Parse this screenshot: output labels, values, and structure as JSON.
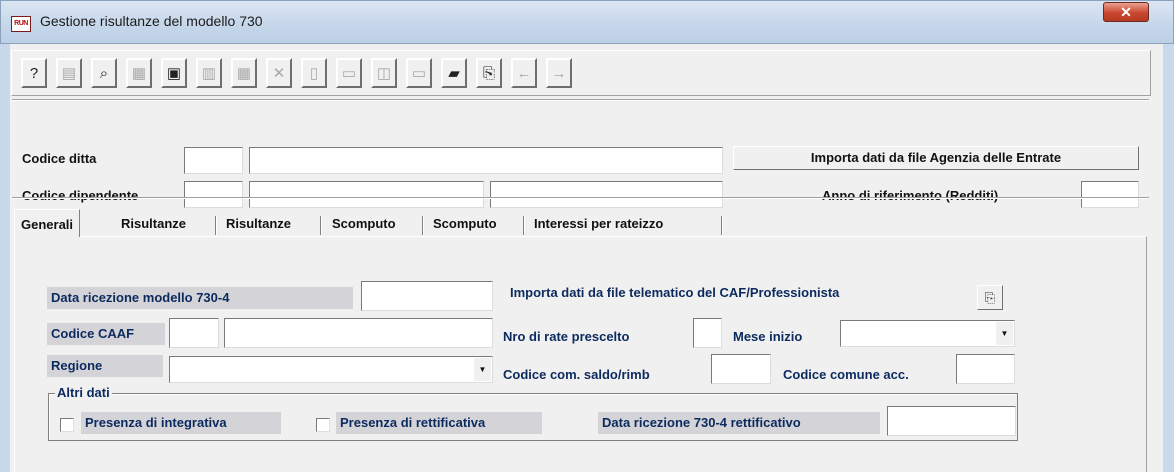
{
  "window": {
    "title": "Gestione risultanze del modello 730",
    "app_icon_text": "RUN",
    "close_glyph": "✕"
  },
  "toolbar": {
    "buttons": [
      {
        "name": "help-icon",
        "glyph": "?",
        "enabled": true
      },
      {
        "name": "properties-icon",
        "glyph": "▤",
        "enabled": false
      },
      {
        "name": "binoculars-icon",
        "glyph": "⌕",
        "enabled": true
      },
      {
        "name": "copy-record-icon",
        "glyph": "▦",
        "enabled": false
      },
      {
        "name": "calculator-icon",
        "glyph": "▣",
        "enabled": true
      },
      {
        "name": "paste-icon",
        "glyph": "▥",
        "enabled": false
      },
      {
        "name": "list-icon",
        "glyph": "▦",
        "enabled": false
      },
      {
        "name": "delete-icon",
        "glyph": "✕",
        "enabled": false
      },
      {
        "name": "preview-icon",
        "glyph": "▯",
        "enabled": false
      },
      {
        "name": "print-icon",
        "glyph": "▭",
        "enabled": false
      },
      {
        "name": "pdf-icon",
        "glyph": "◫",
        "enabled": false
      },
      {
        "name": "form-icon",
        "glyph": "▭",
        "enabled": false
      },
      {
        "name": "open-folder-icon",
        "glyph": "▰",
        "enabled": true
      },
      {
        "name": "import-icon",
        "glyph": "⎘",
        "enabled": true
      },
      {
        "name": "arrow-left-icon",
        "glyph": "←",
        "enabled": false
      },
      {
        "name": "arrow-right-icon",
        "glyph": "→",
        "enabled": false
      }
    ]
  },
  "header": {
    "codice_ditta_label": "Codice ditta",
    "codice_dipendente_label": "Codice dipendente",
    "import_ade_button": "Importa dati da file Agenzia delle Entrate",
    "anno_label": "Anno di riferimento (Redditi)",
    "codice_ditta": "",
    "ragione_sociale": "",
    "codice_dipendente": "",
    "cognome": "",
    "nome": "",
    "anno": ""
  },
  "tabs": [
    {
      "label": "Generali",
      "active": true
    },
    {
      "label": "Risultanze",
      "active": false
    },
    {
      "label": "Risultanze",
      "active": false
    },
    {
      "label": "Scomputo",
      "active": false
    },
    {
      "label": "Scomputo",
      "active": false
    },
    {
      "label": "Interessi per rateizzo",
      "active": false
    }
  ],
  "generali": {
    "data_ricezione_label": "Data ricezione modello 730-4",
    "data_ricezione": "",
    "import_caf_label": "Importa dati da file telematico del CAF/Professionista",
    "import_caf_icon": "copy-icon",
    "codice_caaf_label": "Codice CAAF",
    "codice_caaf": "",
    "descrizione_caaf": "",
    "nro_rate_label": "Nro di  rate prescelto",
    "nro_rate": "",
    "mese_inizio_label": "Mese inizio",
    "mese_inizio": "",
    "regione_label": "Regione",
    "regione": "",
    "codice_com_saldo_label": "Codice com. saldo/rimb",
    "codice_com_saldo": "",
    "codice_comune_acc_label": "Codice comune acc.",
    "codice_comune_acc": "",
    "altri_dati_label": "Altri dati",
    "presenza_integrativa_label": "Presenza di integrativa",
    "presenza_integrativa": false,
    "presenza_rettificativa_label": "Presenza di rettificativa",
    "presenza_rettificativa": false,
    "data_ricezione_rett_label": "Data ricezione 730-4 rettificativo",
    "data_ricezione_rett": ""
  }
}
